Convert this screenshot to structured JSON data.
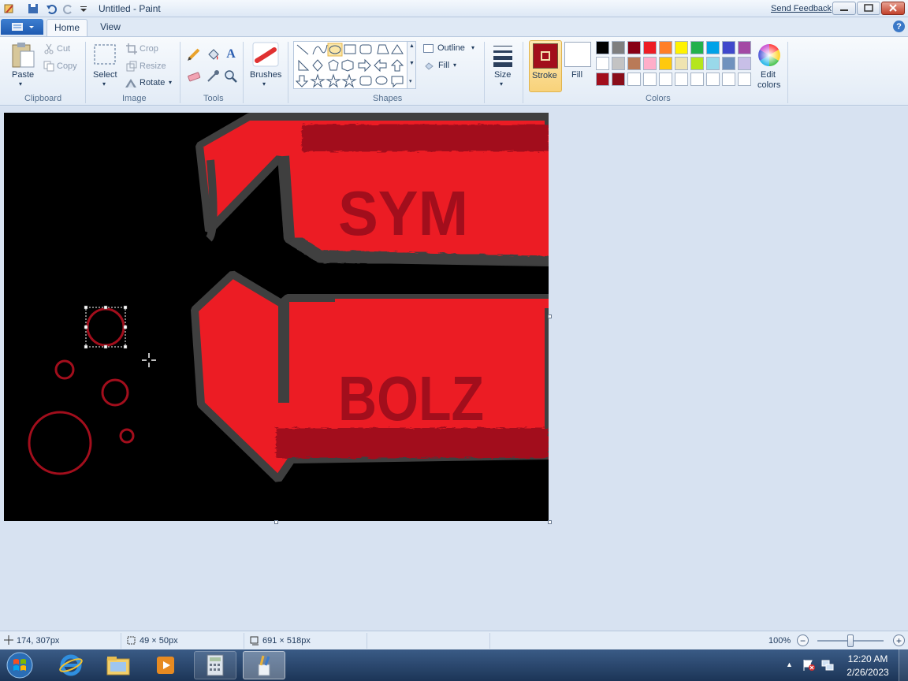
{
  "window": {
    "title": "Untitled - Paint",
    "send_feedback": "Send Feedback"
  },
  "tabs": [
    {
      "label": "Home",
      "active": true
    },
    {
      "label": "View",
      "active": false
    }
  ],
  "ribbon": {
    "clipboard": {
      "paste": "Paste",
      "cut": "Cut",
      "copy": "Copy",
      "group": "Clipboard"
    },
    "image": {
      "select": "Select",
      "crop": "Crop",
      "resize": "Resize",
      "rotate": "Rotate",
      "group": "Image"
    },
    "tools": {
      "group": "Tools"
    },
    "brushes": {
      "label": "Brushes"
    },
    "shapes": {
      "outline": "Outline",
      "fill": "Fill",
      "group": "Shapes"
    },
    "size": {
      "label": "Size"
    },
    "stroke": {
      "label": "Stroke"
    },
    "fill_color": {
      "label": "Fill"
    },
    "colors": {
      "edit_colors_1": "Edit",
      "edit_colors_2": "colors",
      "group": "Colors"
    }
  },
  "palette": {
    "row1": [
      "#000000",
      "#7f7f7f",
      "#880015",
      "#ed1c24",
      "#ff7f27",
      "#fff200",
      "#22b14c",
      "#00a2e8",
      "#3f48cc",
      "#a349a4"
    ],
    "row2": [
      "#ffffff",
      "#c3c3c3",
      "#b97a57",
      "#ffaec9",
      "#ffc90e",
      "#efe4b0",
      "#b5e61d",
      "#99d9ea",
      "#7092be",
      "#c8bfe7"
    ],
    "row3": [
      "#a20e1c",
      "#8a0d19",
      "#ffffff",
      "#ffffff",
      "#ffffff",
      "#ffffff",
      "#ffffff",
      "#ffffff",
      "#ffffff",
      "#ffffff"
    ]
  },
  "stroke_color": "#a20e1c",
  "fill_color": "#ffffff",
  "canvas_art": {
    "text_top": "SYM",
    "text_bottom": "BOLZ"
  },
  "status": {
    "cursor_pos": "174, 307px",
    "selection_size": "49 × 50px",
    "image_size": "691 × 518px",
    "zoom": "100%",
    "zoom_level_percent": 100
  },
  "taskbar": {
    "time": "12:20 AM",
    "date": "2/26/2023"
  }
}
